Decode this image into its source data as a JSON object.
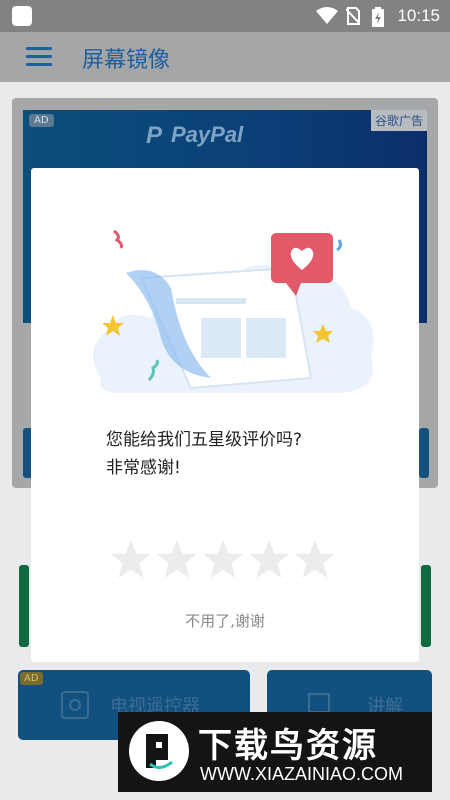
{
  "status_bar": {
    "time": "10:15",
    "icons": [
      "notification-icon",
      "wifi-icon",
      "no-sim-icon",
      "battery-icon"
    ]
  },
  "app_bar": {
    "title": "屏幕镜像",
    "menu_icon": "hamburger-menu-icon"
  },
  "ad": {
    "badge": "AD",
    "tag": "谷歌广告",
    "brand": "PayPal"
  },
  "buttons": {
    "tv_remote": {
      "badge": "AD",
      "label": "电视遥控器",
      "icon": "remote-icon"
    },
    "tutorial": {
      "label": "讲解",
      "icon": "screen-icon"
    }
  },
  "dialog": {
    "message_line1": "您能给我们五星级评价吗?",
    "message_line2": "非常感谢!",
    "rating_max": 5,
    "rating_value": 0,
    "dismiss_label": "不用了,谢谢"
  },
  "watermark": {
    "text": "下载鸟资源",
    "url": "WWW.XIAZAINIAO.COM"
  },
  "colors": {
    "primary": "#1e5fa0",
    "star_empty": "#ececec",
    "heart_bubble": "#e25a6a",
    "confetti_yellow": "#f5c531"
  }
}
